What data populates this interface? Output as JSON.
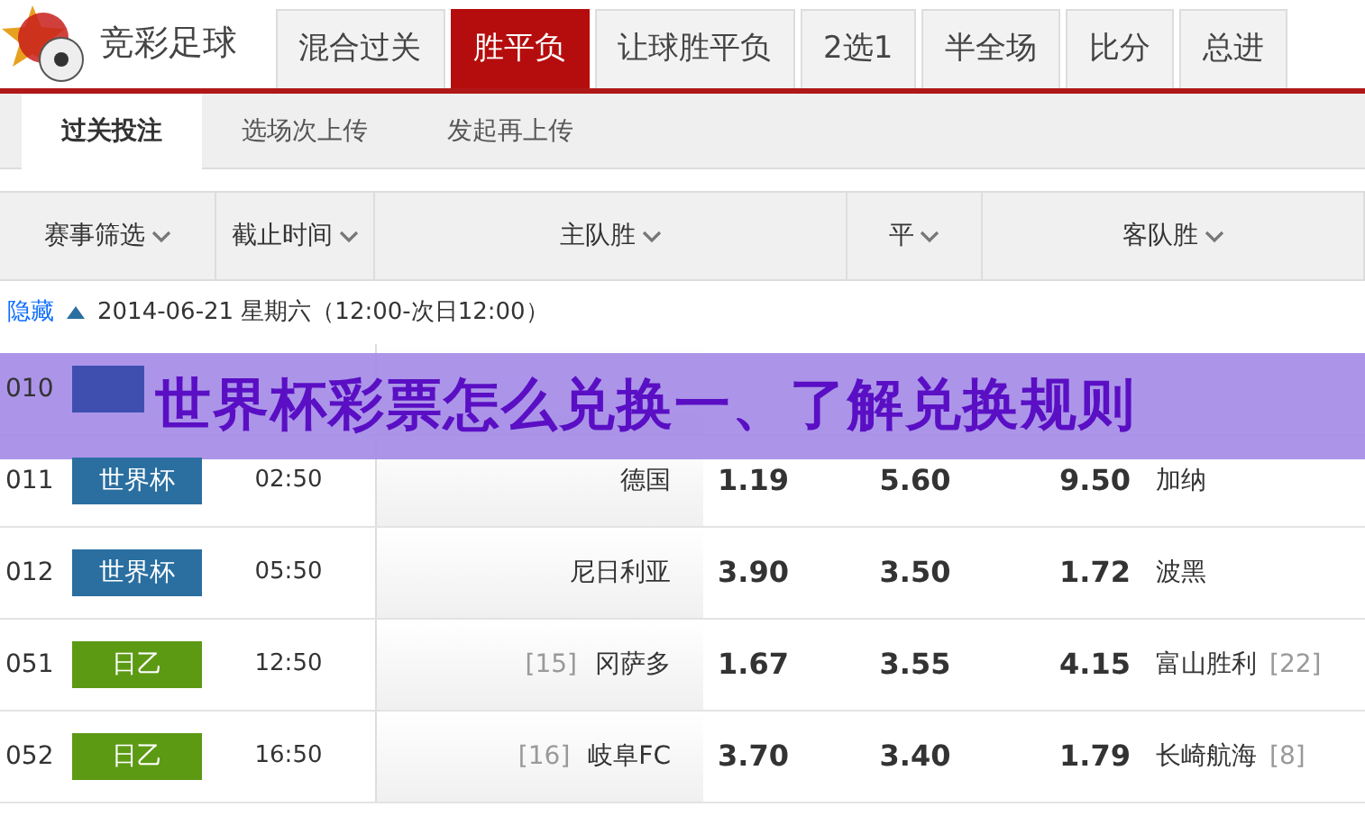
{
  "header": {
    "logo_text": "竞彩足球"
  },
  "tabs": [
    {
      "label": "混合过关",
      "selected": false
    },
    {
      "label": "胜平负",
      "selected": true
    },
    {
      "label": "让球胜平负",
      "selected": false
    },
    {
      "label": "2选1",
      "selected": false
    },
    {
      "label": "半全场",
      "selected": false
    },
    {
      "label": "比分",
      "selected": false
    },
    {
      "label": "总进",
      "selected": false
    }
  ],
  "subtabs": [
    {
      "label": "过关投注",
      "selected": true
    },
    {
      "label": "选场次上传",
      "selected": false
    },
    {
      "label": "发起再上传",
      "selected": false
    }
  ],
  "columns": [
    {
      "label": "赛事筛选"
    },
    {
      "label": "截止时间"
    },
    {
      "label": "主队胜"
    },
    {
      "label": "平"
    },
    {
      "label": "客队胜"
    }
  ],
  "date_bar": {
    "toggle": "隐藏",
    "date": "2014-06-21 星期六（12:00-次日12:00）"
  },
  "matches": [
    {
      "number": "010",
      "league": {
        "color": "#3f4fb0"
      }
    },
    {
      "number": "011",
      "league": {
        "label": "世界杯",
        "color": "#2a6fa0"
      },
      "time": "02:50",
      "home": "德国",
      "home_odds": "1.19",
      "draw_odds": "5.60",
      "away_odds": "9.50",
      "away": "加纳"
    },
    {
      "number": "012",
      "league": {
        "label": "世界杯",
        "color": "#2a6fa0"
      },
      "time": "05:50",
      "home": "尼日利亚",
      "home_odds": "3.90",
      "draw_odds": "3.50",
      "away_odds": "1.72",
      "away": "波黑"
    },
    {
      "number": "051",
      "league": {
        "label": "日乙",
        "color": "#5c9a14"
      },
      "time": "12:50",
      "home_rank": "[15]",
      "home": "冈萨多",
      "home_odds": "1.67",
      "draw_odds": "3.55",
      "away_odds": "4.15",
      "away": "富山胜利",
      "away_rank": "[22]"
    },
    {
      "number": "052",
      "league": {
        "label": "日乙",
        "color": "#5c9a14"
      },
      "time": "16:50",
      "home_rank": "[16]",
      "home": "岐阜FC",
      "home_odds": "3.70",
      "draw_odds": "3.40",
      "away_odds": "1.79",
      "away": "长崎航海",
      "away_rank": "[8]"
    }
  ],
  "banner": {
    "text": "世界杯彩票怎么兑换一、了解兑换规则"
  }
}
